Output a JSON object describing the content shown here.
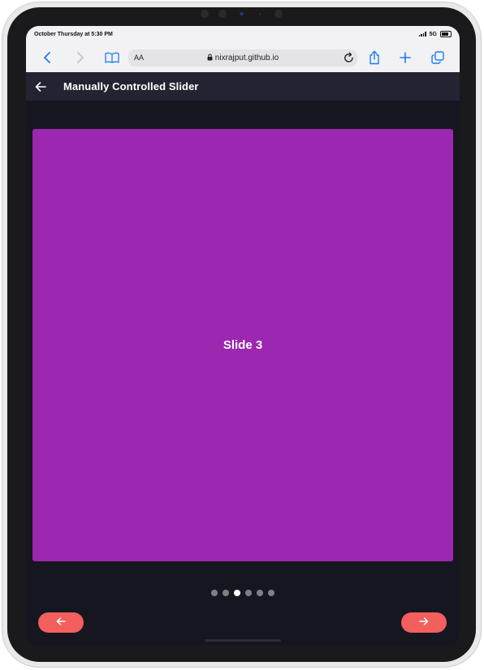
{
  "status_bar": {
    "time": "October Thursday at 5:30 PM",
    "network": "5G"
  },
  "browser": {
    "text_size_label": "AA",
    "url": "nixrajput.github.io",
    "icons": [
      "chevron-left-icon",
      "chevron-right-icon",
      "book-icon",
      "lock-icon",
      "reload-icon",
      "share-icon",
      "plus-icon",
      "tabs-icon"
    ]
  },
  "app_bar": {
    "title": "Manually Controlled Slider"
  },
  "slider": {
    "current_slide_label": "Slide 3",
    "slide_color": "#9c27b0",
    "total_slides": 6,
    "active_index": 2
  },
  "controls": {
    "prev_icon": "arrow-left-icon",
    "next_icon": "arrow-right-icon",
    "button_color": "#f25f5c"
  },
  "colors": {
    "background": "#161621",
    "app_bar": "#232333",
    "browser_accent": "#1a7cf5"
  }
}
